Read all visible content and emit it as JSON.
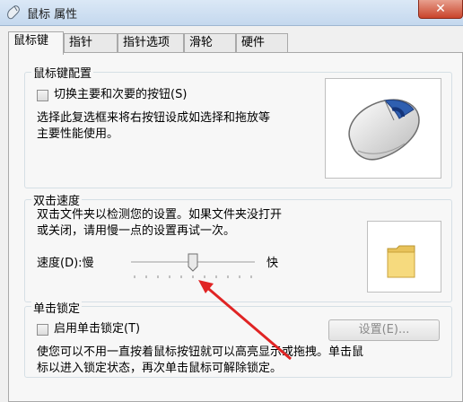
{
  "window": {
    "title": "鼠标 属性",
    "close_label": "✕"
  },
  "tabs": [
    {
      "label": "鼠标键",
      "active": true
    },
    {
      "label": "指针",
      "active": false
    },
    {
      "label": "指针选项",
      "active": false
    },
    {
      "label": "滑轮",
      "active": false
    },
    {
      "label": "硬件",
      "active": false
    }
  ],
  "button_config": {
    "group_title": "鼠标键配置",
    "checkbox_label": "切换主要和次要的按钮(S)",
    "checked": false,
    "description_lines": [
      "选择此复选框来将右按钮设成如选择和拖放等",
      "主要性能使用。"
    ]
  },
  "double_click": {
    "group_title": "双击速度",
    "description_lines": [
      "双击文件夹以检测您的设置。如果文件夹没打开",
      "或关闭，请用慢一点的设置再试一次。"
    ],
    "speed_label": "速度(D):慢",
    "fast_label": "快",
    "slider_value": 0.5,
    "slider_ticks": 11
  },
  "click_lock": {
    "group_title": "单击锁定",
    "checkbox_label": "启用单击锁定(T)",
    "checked": false,
    "settings_button": "设置(E)...",
    "description_lines": [
      "使您可以不用一直按着鼠标按钮就可以高亮显示或拖拽。单击鼠",
      "标以进入锁定状态，再次单击鼠标可解除锁定。"
    ]
  },
  "annotation": {
    "arrow_color": "#e02424"
  }
}
